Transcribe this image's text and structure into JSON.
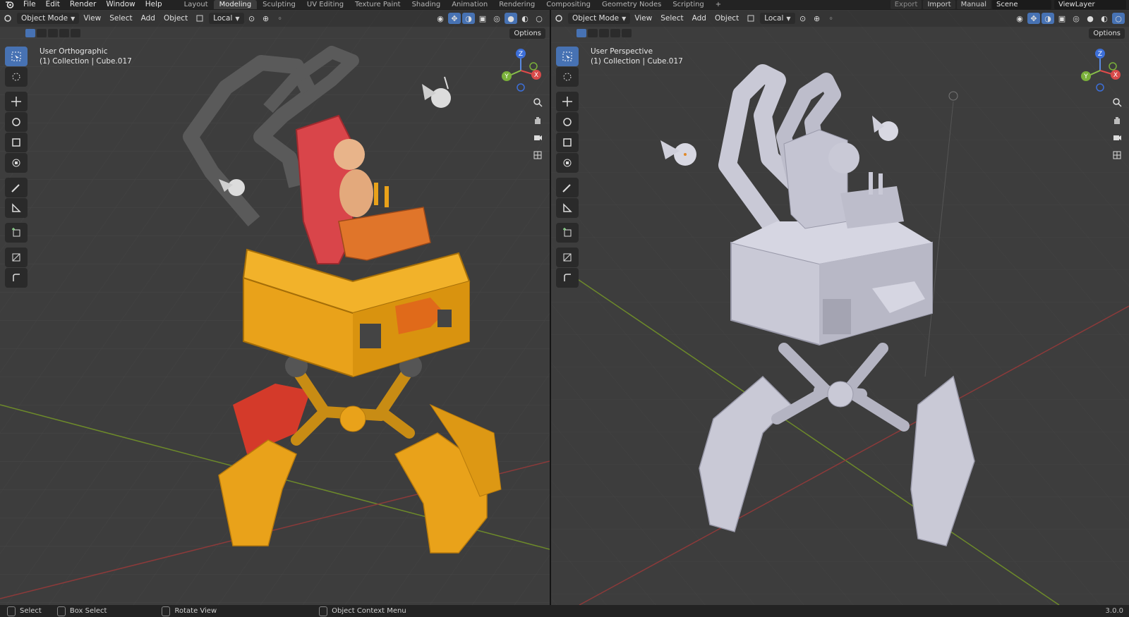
{
  "menus": [
    "File",
    "Edit",
    "Render",
    "Window",
    "Help"
  ],
  "workspaces": [
    "Layout",
    "Modeling",
    "Sculpting",
    "UV Editing",
    "Texture Paint",
    "Shading",
    "Animation",
    "Rendering",
    "Compositing",
    "Geometry Nodes",
    "Scripting"
  ],
  "active_workspace": "Modeling",
  "topright": {
    "export": "Export",
    "import": "Import",
    "manual": "Manual",
    "scene": "Scene",
    "view_layer": "ViewLayer"
  },
  "viewport_header": {
    "mode": "Object Mode",
    "view": "View",
    "select": "Select",
    "add": "Add",
    "object": "Object",
    "transform": "Local",
    "options": "Options"
  },
  "left_viewport": {
    "view_name": "User Orthographic",
    "collection": "(1) Collection | Cube.017"
  },
  "right_viewport": {
    "view_name": "User Perspective",
    "collection": "(1) Collection | Cube.017"
  },
  "gizmo_axes": {
    "x": "X",
    "y": "Y",
    "z": "Z"
  },
  "status": {
    "select": "Select",
    "box_select": "Box Select",
    "rotate": "Rotate View",
    "context": "Object Context Menu",
    "version": "3.0.0"
  },
  "colors": {
    "accent": "#4772b3",
    "viewport_bg": "#3d3d3d",
    "orange_body": "#e9a21a",
    "red_seat": "#d9454a",
    "white_model": "#c9c9d6"
  },
  "icons": [
    "blender-logo",
    "select-box-icon",
    "cursor-icon",
    "move-icon",
    "rotate-icon",
    "scale-icon",
    "transform-icon",
    "annotate-icon",
    "measure-icon",
    "add-cube-icon",
    "shrink-icon",
    "shear-icon",
    "zoom-icon",
    "hand-icon",
    "camera-icon",
    "grid-icon"
  ]
}
